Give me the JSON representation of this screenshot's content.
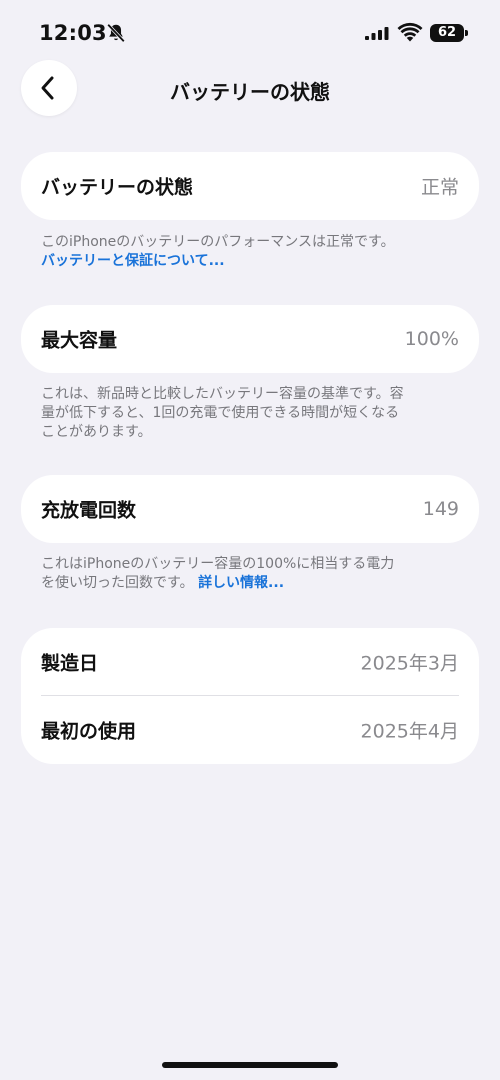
{
  "status_bar": {
    "time": "12:03",
    "battery_level": "62"
  },
  "nav": {
    "title": "バッテリーの状態"
  },
  "battery_state": {
    "label": "バッテリーの状態",
    "value": "正常",
    "footnote": "このiPhoneのバッテリーのパフォーマンスは正常です。",
    "link": "バッテリーと保証について..."
  },
  "max_capacity": {
    "label": "最大容量",
    "value": "100%",
    "footnote_line1": "これは、新品時と比較したバッテリー容量の基準です。容",
    "footnote_line2": "量が低下すると、1回の充電で使用できる時間が短くなる",
    "footnote_line3": "ことがあります。"
  },
  "cycle_count": {
    "label": "充放電回数",
    "value": "149",
    "footnote_line1": "これはiPhoneのバッテリー容量の100%に相当する電力",
    "footnote_line2": "を使い切った回数です。",
    "link": "詳しい情報..."
  },
  "dates": {
    "manufacture_label": "製造日",
    "manufacture_value": "2025年3月",
    "first_use_label": "最初の使用",
    "first_use_value": "2025年4月"
  },
  "colors": {
    "background": "#f2f1f7",
    "card": "#ffffff",
    "link": "#1a73d9",
    "secondary_text": "#8a8a8e"
  }
}
